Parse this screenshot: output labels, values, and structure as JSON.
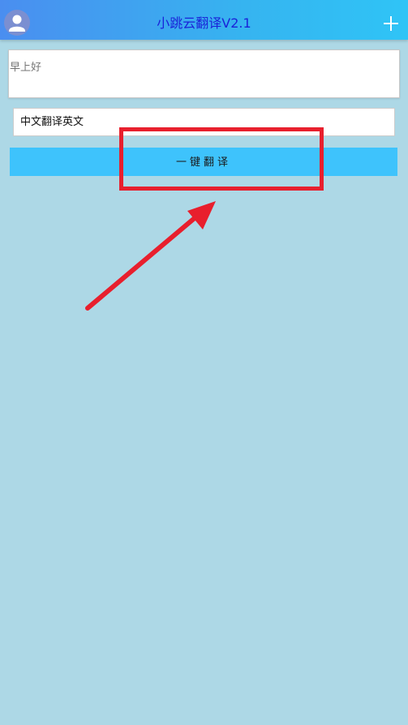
{
  "header": {
    "title": "小跳云翻译V2.1",
    "avatar_icon": "user-avatar-icon",
    "add_icon": "plus-icon"
  },
  "source": {
    "placeholder": "早上好"
  },
  "mode": {
    "selected": "中文翻译英文"
  },
  "translate_button": {
    "label": "一键翻译"
  },
  "colors": {
    "header_start": "#4a8ef0",
    "header_end": "#2fc4f6",
    "title": "#1a23d8",
    "background": "#add8e6",
    "button": "#3ec3fc",
    "annotation": "#e81f2d"
  }
}
